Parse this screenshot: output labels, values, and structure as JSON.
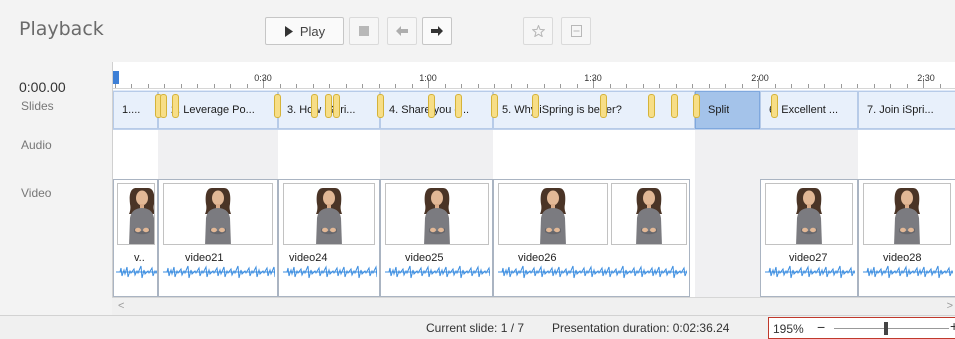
{
  "header": {
    "title": "Playback",
    "play_label": "Play"
  },
  "panel": {
    "timecode": "0:00.00",
    "slides_label": "Slides",
    "audio_label": "Audio",
    "video_label": "Video"
  },
  "ruler": {
    "labels": [
      "0:30",
      "1:00",
      "1:30",
      "2:00",
      "2:30"
    ]
  },
  "slides": [
    {
      "label": "1...."
    },
    {
      "label": "2. Leverage Po..."
    },
    {
      "label": "3. How iSpri..."
    },
    {
      "label": "4. Share you c..."
    },
    {
      "label": "5. Why iSpring is better?"
    },
    {
      "label": "Split"
    },
    {
      "label": "6. Excellent ..."
    },
    {
      "label": "7. Join iSpri..."
    }
  ],
  "clips": [
    {
      "label": "v.."
    },
    {
      "label": "video21"
    },
    {
      "label": "video24"
    },
    {
      "label": "video25"
    },
    {
      "label": "video26"
    },
    {
      "label": "video27"
    },
    {
      "label": "video28"
    }
  ],
  "status": {
    "current_slide": "Current slide: 1 / 7",
    "duration": "Presentation duration: 0:02:36.24",
    "zoom": "195%",
    "zoom_minus": "−",
    "zoom_plus": "+",
    "zoom_level": 0.45
  },
  "colors": {
    "playhead": "#3d7fd6",
    "split": "#a4c3ea",
    "waveform": "#3b8de0",
    "marker": "#f7de87"
  },
  "icons": {
    "play": "play-icon",
    "stop": "stop-icon",
    "prev": "arrow-left-icon",
    "next": "arrow-right-icon",
    "star": "star-icon",
    "bookmark": "bookmark-icon"
  }
}
